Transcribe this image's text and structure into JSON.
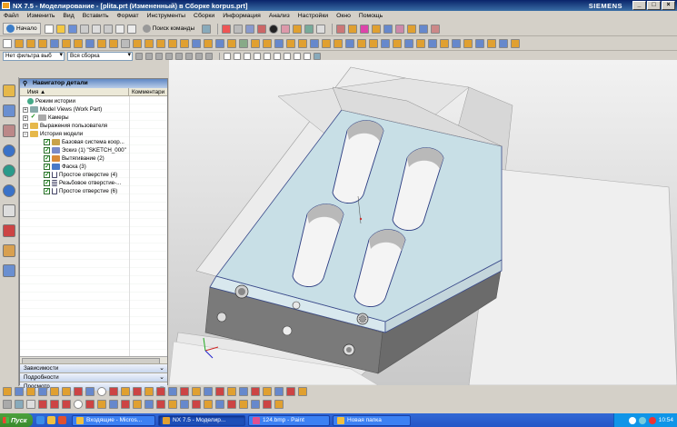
{
  "window": {
    "title": "NX 7.5 - Моделирование - [plita.prt (Измененный)  в Сборке korpus.prt]",
    "brand": "SIEMENS",
    "controls": [
      "_",
      "□",
      "×"
    ]
  },
  "menu": [
    "Файл",
    "Изменить",
    "Вид",
    "Вставить",
    "Формат",
    "Инструменты",
    "Сборки",
    "Информация",
    "Анализ",
    "Настройки",
    "Окно",
    "Помощь"
  ],
  "toolbar": {
    "start_label": "Начало",
    "find_command_label": "Поиск команды"
  },
  "filters": {
    "selection_filter": "Нет фильтра выб",
    "scope": "Вся сборка"
  },
  "navigator": {
    "title": "Навигатор детали",
    "col_name": "Имя",
    "col_comment": "Комментари",
    "items": [
      {
        "label": "Режим истории",
        "level": 0
      },
      {
        "label": "Model Views (Work Part)",
        "level": 0
      },
      {
        "label": "Камеры",
        "level": 0
      },
      {
        "label": "Выражения пользователя",
        "level": 0
      },
      {
        "label": "История модели",
        "level": 0
      },
      {
        "label": "Базовая система коор...",
        "level": 1
      },
      {
        "label": "Эскиз (1) \"SKETCH_000\"",
        "level": 1
      },
      {
        "label": "Вытягивание (2)",
        "level": 1
      },
      {
        "label": "Фаска (3)",
        "level": 1
      },
      {
        "label": "Простое отверстие (4)",
        "level": 1
      },
      {
        "label": "Резьбовое отверстие-...",
        "level": 1
      },
      {
        "label": "Простое отверстие (6)",
        "level": 1
      }
    ],
    "panels": [
      "Зависимости",
      "Подробности",
      "Просмотр"
    ]
  },
  "taskbar": {
    "start": "Пуск",
    "tasks": [
      "Входящие - Micros...",
      "NX 7.5 - Моделир...",
      "124.bmp - Paint",
      "Новая папка"
    ],
    "clock": "10:54"
  }
}
